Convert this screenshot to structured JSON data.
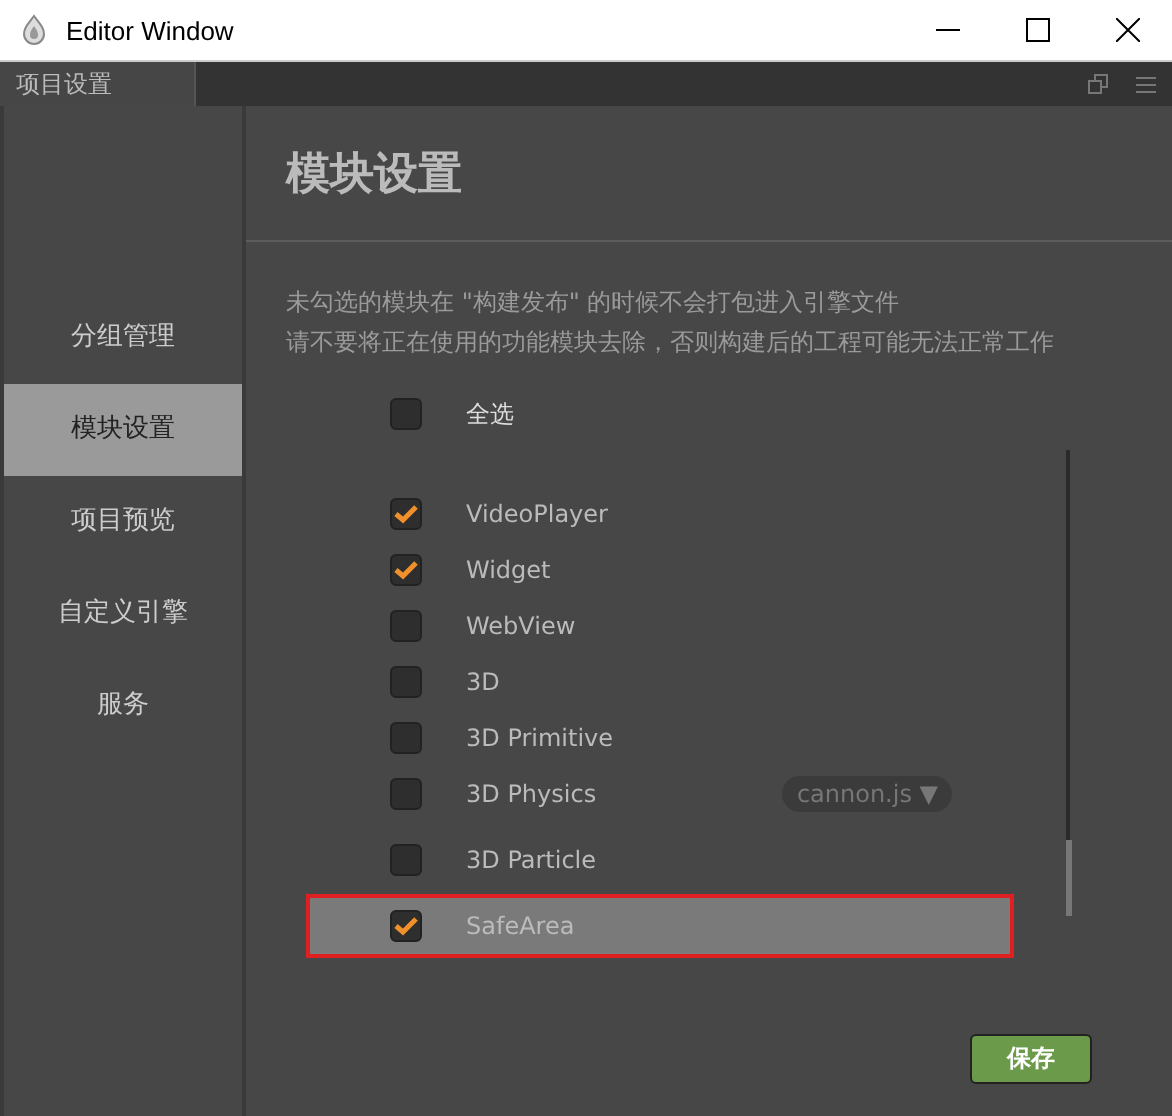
{
  "window": {
    "title": "Editor Window"
  },
  "tab": {
    "label": "项目设置"
  },
  "sidebar": {
    "items": [
      {
        "label": "分组管理",
        "selected": false
      },
      {
        "label": "模块设置",
        "selected": true
      },
      {
        "label": "项目预览",
        "selected": false
      },
      {
        "label": "自定义引擎",
        "selected": false
      },
      {
        "label": "服务",
        "selected": false
      }
    ]
  },
  "content": {
    "heading": "模块设置",
    "notes": [
      "未勾选的模块在 \"构建发布\" 的时候不会打包进入引擎文件",
      "请不要将正在使用的功能模块去除，否则构建后的工程可能无法正常工作"
    ],
    "select_all": {
      "label": "全选",
      "checked": false
    },
    "modules": [
      {
        "name": "VideoPlayer",
        "checked": true,
        "selected": false
      },
      {
        "name": "Widget",
        "checked": true,
        "selected": false
      },
      {
        "name": "WebView",
        "checked": false,
        "selected": false
      },
      {
        "name": "3D",
        "checked": false,
        "selected": false
      },
      {
        "name": "3D Primitive",
        "checked": false,
        "selected": false
      },
      {
        "name": "3D Physics",
        "checked": false,
        "selected": false,
        "dropdown": "cannon.js ▼"
      },
      {
        "name": "3D Particle",
        "checked": false,
        "selected": false
      },
      {
        "name": "SafeArea",
        "checked": true,
        "selected": true
      }
    ],
    "save_button": "保存"
  }
}
